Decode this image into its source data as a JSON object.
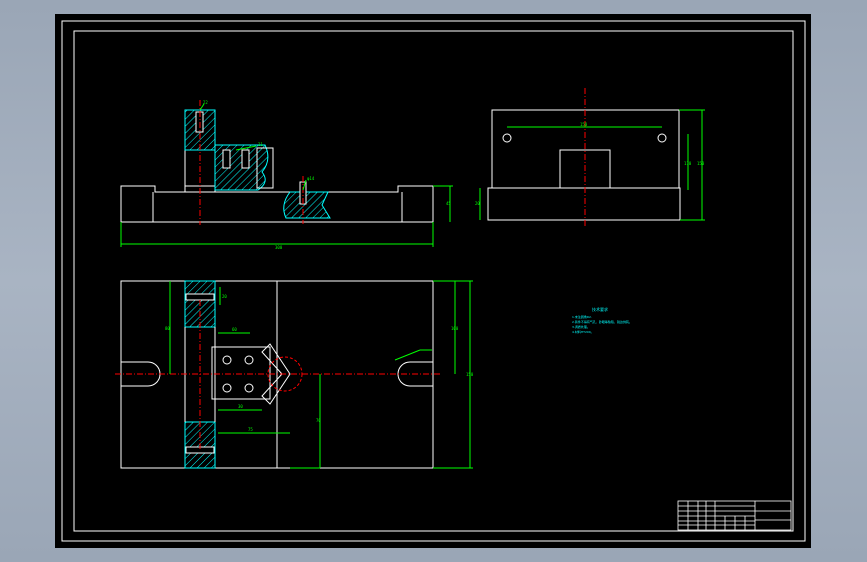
{
  "viewer": {
    "background_color": "#a3aebd",
    "canvas_color": "#000000",
    "border_color": "#ffffff",
    "part_line_color": "#ffffff",
    "dimension_color": "#00ff00",
    "centerline_color": "#ff0000",
    "annotation_color": "#00ffff"
  },
  "drawing": {
    "front_view": {
      "overall_width_dim": "300",
      "height_dim": "45",
      "callout_1": "22",
      "callout_2": "21",
      "callout_3": "φ14"
    },
    "side_view": {
      "width_dim": "150",
      "height_dim_1": "110",
      "height_dim_2": "150",
      "base_dim": "20"
    },
    "top_view": {
      "dim_a": "20",
      "dim_b": "80",
      "dim_c": "75",
      "dim_d": "60",
      "dim_e": "150",
      "dim_f": "100",
      "dim_g": "30",
      "dim_h": "70"
    },
    "notes": {
      "title": "技术要求",
      "lines": [
        "1.未注圆角R2.",
        "2.铸件不得有气孔、砂眼等缺陷，锐边倒钝。",
        "3.调质处理。",
        "4.材料HT200。"
      ]
    }
  }
}
